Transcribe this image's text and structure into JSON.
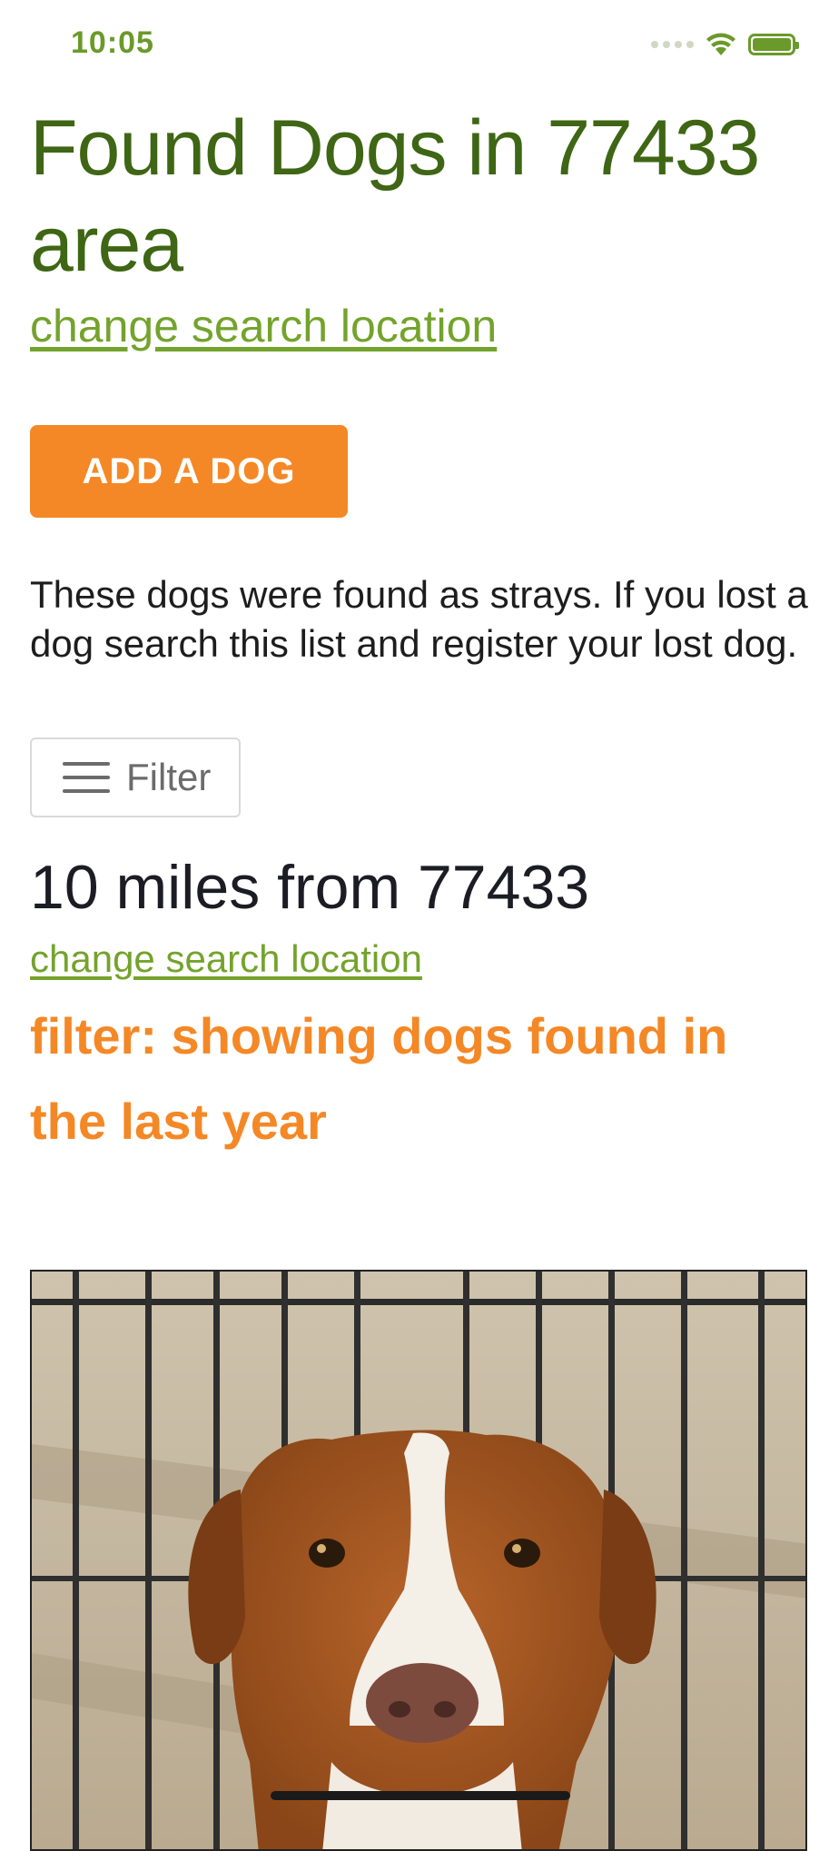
{
  "status_bar": {
    "time": "10:05"
  },
  "header": {
    "title": "Found Dogs in 77433 area",
    "change_location_link": "change search location"
  },
  "actions": {
    "add_dog_label": "ADD A DOG"
  },
  "intro": {
    "text": "These dogs were found as strays. If you lost a dog search this list and register your lost dog."
  },
  "filter": {
    "button_label": "Filter"
  },
  "results": {
    "distance_heading": "10 miles from 77433",
    "change_location_link": "change search location",
    "filter_note": "filter: showing dogs found in the last year"
  },
  "colors": {
    "brand_green": "#3e6614",
    "link_green": "#74a32c",
    "accent_orange": "#f48826"
  },
  "icons": [
    "wifi-icon",
    "battery-icon",
    "signal-icon",
    "hamburger-menu-icon"
  ]
}
